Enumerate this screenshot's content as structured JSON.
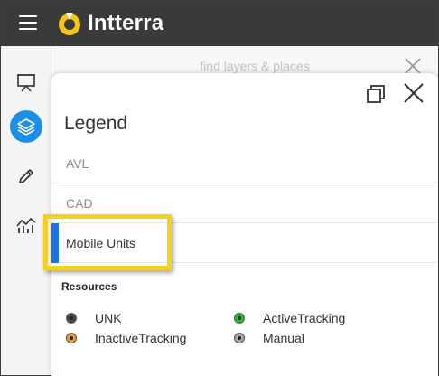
{
  "app": {
    "brand": "Intterra"
  },
  "search": {
    "placeholder": "find layers & places"
  },
  "legend": {
    "title": "Legend",
    "sections": [
      {
        "label": "AVL"
      },
      {
        "label": "CAD"
      },
      {
        "label": "Mobile Units",
        "selected": true
      }
    ],
    "resources": {
      "title": "Resources",
      "items": [
        {
          "label": "UNK",
          "color": "#4a4a4a"
        },
        {
          "label": "ActiveTracking",
          "color": "#22c232"
        },
        {
          "label": "InactiveTracking",
          "color": "#f09a2a"
        },
        {
          "label": "Manual",
          "color": "#a8a8a8"
        }
      ]
    }
  },
  "colors": {
    "topbar": "#3a3a3a",
    "accent": "#1a8fe3",
    "highlight": "#f2d024",
    "logo": "#f5c518"
  },
  "icons": {
    "menu": "hamburger-icon",
    "logo": "intterra-logo",
    "presentation": "presentation-icon",
    "layers": "layers-icon",
    "draw": "pencil-icon",
    "analytics": "chart-icon",
    "popout": "popout-icon",
    "close": "close-icon"
  }
}
